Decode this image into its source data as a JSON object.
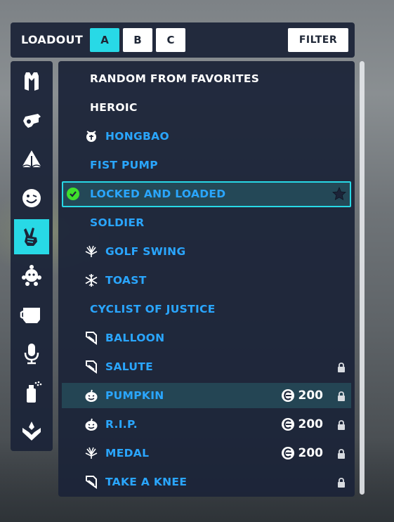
{
  "header": {
    "title": "LOADOUT",
    "tabs": [
      {
        "label": "A",
        "active": true
      },
      {
        "label": "B",
        "active": false
      },
      {
        "label": "C",
        "active": false
      }
    ],
    "filter_label": "FILTER"
  },
  "sidebar": {
    "categories": [
      {
        "icon": "outfit-icon"
      },
      {
        "icon": "weapon-charm-icon"
      },
      {
        "icon": "spray-icon"
      },
      {
        "icon": "emote-face-icon"
      },
      {
        "icon": "victory-pose-icon",
        "active": true
      },
      {
        "icon": "souvenir-icon"
      },
      {
        "icon": "mug-icon"
      },
      {
        "icon": "voice-line-icon"
      },
      {
        "icon": "spray-can-icon"
      },
      {
        "icon": "highlight-intro-icon"
      }
    ]
  },
  "items": [
    {
      "label": "RANDOM FROM FAVORITES",
      "color": "white"
    },
    {
      "label": "HEROIC",
      "color": "white"
    },
    {
      "label": "HONGBAO",
      "rarity_icon": "lunar-event-icon"
    },
    {
      "label": "FIST PUMP"
    },
    {
      "label": "LOCKED AND LOADED",
      "equipped": true,
      "favorite": true
    },
    {
      "label": "SOLDIER"
    },
    {
      "label": "GOLF SWING",
      "rarity_icon": "summer-games-icon"
    },
    {
      "label": "TOAST",
      "rarity_icon": "winter-event-icon"
    },
    {
      "label": "CYCLIST OF JUSTICE"
    },
    {
      "label": "BALLOON",
      "rarity_icon": "season-badge-icon"
    },
    {
      "label": "SALUTE",
      "rarity_icon": "season-badge-icon",
      "locked": true
    },
    {
      "label": "PUMPKIN",
      "rarity_icon": "halloween-icon",
      "price": "200",
      "locked": true,
      "hover": true
    },
    {
      "label": "R.I.P.",
      "rarity_icon": "halloween-icon",
      "price": "200",
      "locked": true
    },
    {
      "label": "MEDAL",
      "rarity_icon": "summer-games-icon",
      "price": "200",
      "locked": true
    },
    {
      "label": "TAKE A KNEE",
      "rarity_icon": "season-badge-icon",
      "locked": true
    }
  ],
  "colors": {
    "accent": "#28d9e6",
    "item_text": "#2aa6ff",
    "panel_bg": "#1c2438",
    "equipped_check": "#3fe02c"
  }
}
